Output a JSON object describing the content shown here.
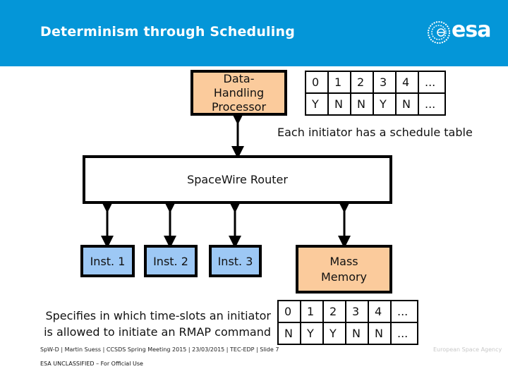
{
  "header": {
    "title": "Determinism through Scheduling",
    "logo_text": "esa",
    "color": "#0496d8"
  },
  "diagram": {
    "dhp_label": [
      "Data-",
      "Handling",
      "Processor"
    ],
    "router_label": "SpaceWire Router",
    "instruments": [
      "Inst. 1",
      "Inst. 2",
      "Inst. 3"
    ],
    "mass_memory_label": [
      "Mass",
      "Memory"
    ],
    "colors": {
      "processor": "#fbcb9c",
      "instrument": "#9dc8f5",
      "memory": "#fbcb9c"
    }
  },
  "schedule_table_top": {
    "slots": [
      "0",
      "1",
      "2",
      "3",
      "4",
      "..."
    ],
    "allowed": [
      "Y",
      "N",
      "N",
      "Y",
      "N",
      "..."
    ]
  },
  "schedule_table_bottom": {
    "slots": [
      "0",
      "1",
      "2",
      "3",
      "4",
      "..."
    ],
    "allowed": [
      "N",
      "Y",
      "Y",
      "N",
      "N",
      "..."
    ]
  },
  "notes": {
    "top": "Each initiator has a schedule table",
    "bottom": [
      "Specifies in which time-slots an initiator",
      "is allowed to initiate an RMAP command"
    ]
  },
  "footer": {
    "line1": "SpW-D | Martin Suess | CCSDS Spring Meeting 2015 | 23/03/2015 | TEC-EDP | Slide  7",
    "line2": "ESA UNCLASSIFIED – For Official Use",
    "agency": "European Space Agency"
  }
}
